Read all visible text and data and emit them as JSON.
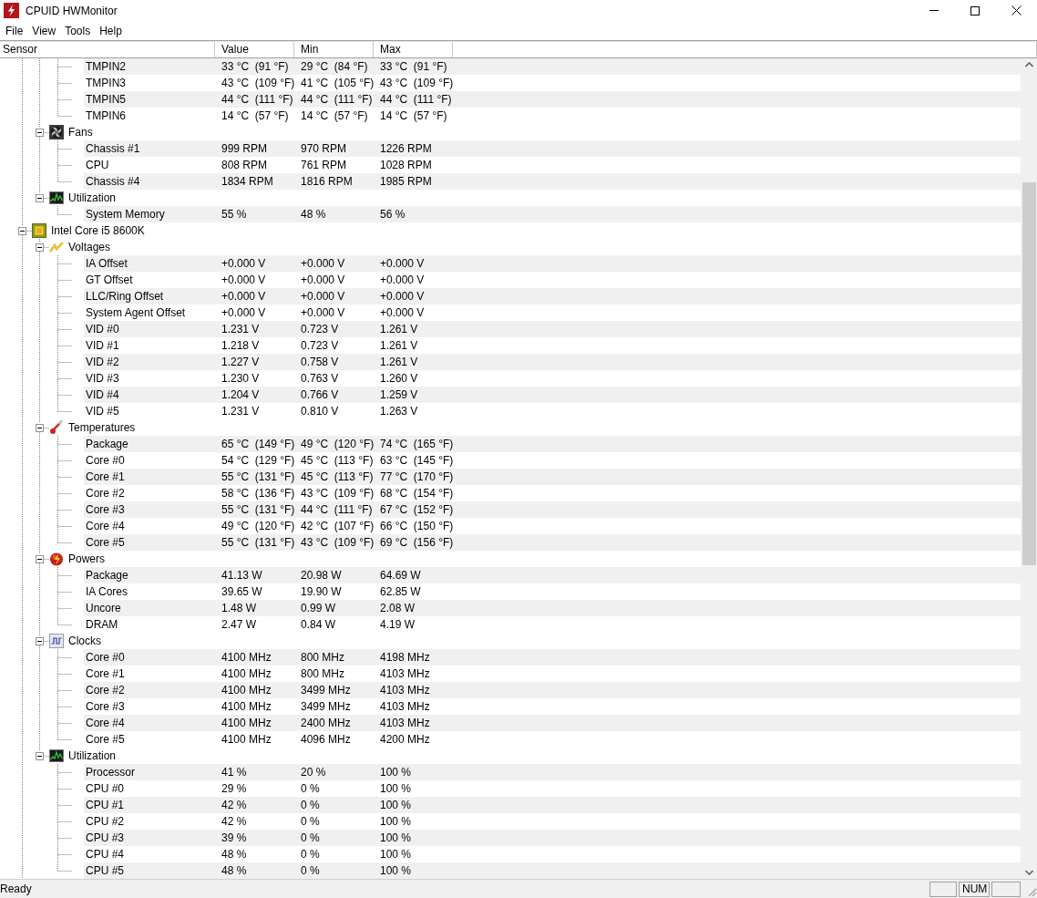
{
  "window": {
    "title": "CPUID HWMonitor"
  },
  "menu": [
    "File",
    "View",
    "Tools",
    "Help"
  ],
  "columns": [
    "Sensor",
    "Value",
    "Min",
    "Max"
  ],
  "tree": [
    {
      "children": [
        {
          "children": [
            {
              "label": "TMPIN2",
              "value": "33 °C  (91 °F)",
              "min": "29 °C  (84 °F)",
              "max": "33 °C  (91 °F)"
            },
            {
              "label": "TMPIN3",
              "value": "43 °C  (109 °F)",
              "min": "41 °C  (105 °F)",
              "max": "43 °C  (109 °F)"
            },
            {
              "label": "TMPIN5",
              "value": "44 °C  (111 °F)",
              "min": "44 °C  (111 °F)",
              "max": "44 °C  (111 °F)"
            },
            {
              "label": "TMPIN6",
              "value": "14 °C  (57 °F)",
              "min": "14 °C  (57 °F)",
              "max": "14 °C  (57 °F)"
            }
          ]
        },
        {
          "label": "Fans",
          "kind": "fans",
          "expanded": true,
          "children": [
            {
              "label": "Chassis #1",
              "value": "999 RPM",
              "min": "970 RPM",
              "max": "1226 RPM"
            },
            {
              "label": "CPU",
              "value": "808 RPM",
              "min": "761 RPM",
              "max": "1028 RPM"
            },
            {
              "label": "Chassis #4",
              "value": "1834 RPM",
              "min": "1816 RPM",
              "max": "1985 RPM"
            }
          ]
        },
        {
          "label": "Utilization",
          "kind": "utilization",
          "expanded": true,
          "children": [
            {
              "label": "System Memory",
              "value": "55 %",
              "min": "48 %",
              "max": "56 %"
            }
          ]
        }
      ]
    },
    {
      "label": "Intel Core i5 8600K",
      "kind": "processor",
      "expanded": true,
      "children": [
        {
          "label": "Voltages",
          "kind": "voltages",
          "expanded": true,
          "children": [
            {
              "label": "IA Offset",
              "value": "+0.000 V",
              "min": "+0.000 V",
              "max": "+0.000 V"
            },
            {
              "label": "GT Offset",
              "value": "+0.000 V",
              "min": "+0.000 V",
              "max": "+0.000 V"
            },
            {
              "label": "LLC/Ring Offset",
              "value": "+0.000 V",
              "min": "+0.000 V",
              "max": "+0.000 V"
            },
            {
              "label": "System Agent Offset",
              "value": "+0.000 V",
              "min": "+0.000 V",
              "max": "+0.000 V"
            },
            {
              "label": "VID #0",
              "value": "1.231 V",
              "min": "0.723 V",
              "max": "1.261 V"
            },
            {
              "label": "VID #1",
              "value": "1.218 V",
              "min": "0.723 V",
              "max": "1.261 V"
            },
            {
              "label": "VID #2",
              "value": "1.227 V",
              "min": "0.758 V",
              "max": "1.261 V"
            },
            {
              "label": "VID #3",
              "value": "1.230 V",
              "min": "0.763 V",
              "max": "1.260 V"
            },
            {
              "label": "VID #4",
              "value": "1.204 V",
              "min": "0.766 V",
              "max": "1.259 V"
            },
            {
              "label": "VID #5",
              "value": "1.231 V",
              "min": "0.810 V",
              "max": "1.263 V"
            }
          ]
        },
        {
          "label": "Temperatures",
          "kind": "temperatures",
          "expanded": true,
          "children": [
            {
              "label": "Package",
              "value": "65 °C  (149 °F)",
              "min": "49 °C  (120 °F)",
              "max": "74 °C  (165 °F)"
            },
            {
              "label": "Core #0",
              "value": "54 °C  (129 °F)",
              "min": "45 °C  (113 °F)",
              "max": "63 °C  (145 °F)"
            },
            {
              "label": "Core #1",
              "value": "55 °C  (131 °F)",
              "min": "45 °C  (113 °F)",
              "max": "77 °C  (170 °F)"
            },
            {
              "label": "Core #2",
              "value": "58 °C  (136 °F)",
              "min": "43 °C  (109 °F)",
              "max": "68 °C  (154 °F)"
            },
            {
              "label": "Core #3",
              "value": "55 °C  (131 °F)",
              "min": "44 °C  (111 °F)",
              "max": "67 °C  (152 °F)"
            },
            {
              "label": "Core #4",
              "value": "49 °C  (120 °F)",
              "min": "42 °C  (107 °F)",
              "max": "66 °C  (150 °F)"
            },
            {
              "label": "Core #5",
              "value": "55 °C  (131 °F)",
              "min": "43 °C  (109 °F)",
              "max": "69 °C  (156 °F)"
            }
          ]
        },
        {
          "label": "Powers",
          "kind": "powers",
          "expanded": true,
          "children": [
            {
              "label": "Package",
              "value": "41.13 W",
              "min": "20.98 W",
              "max": "64.69 W"
            },
            {
              "label": "IA Cores",
              "value": "39.65 W",
              "min": "19.90 W",
              "max": "62.85 W"
            },
            {
              "label": "Uncore",
              "value": "1.48 W",
              "min": "0.99 W",
              "max": "2.08 W"
            },
            {
              "label": "DRAM",
              "value": "2.47 W",
              "min": "0.84 W",
              "max": "4.19 W"
            }
          ]
        },
        {
          "label": "Clocks",
          "kind": "clocks",
          "expanded": true,
          "children": [
            {
              "label": "Core #0",
              "value": "4100 MHz",
              "min": "800 MHz",
              "max": "4198 MHz"
            },
            {
              "label": "Core #1",
              "value": "4100 MHz",
              "min": "800 MHz",
              "max": "4103 MHz"
            },
            {
              "label": "Core #2",
              "value": "4100 MHz",
              "min": "3499 MHz",
              "max": "4103 MHz"
            },
            {
              "label": "Core #3",
              "value": "4100 MHz",
              "min": "3499 MHz",
              "max": "4103 MHz"
            },
            {
              "label": "Core #4",
              "value": "4100 MHz",
              "min": "2400 MHz",
              "max": "4103 MHz"
            },
            {
              "label": "Core #5",
              "value": "4100 MHz",
              "min": "4096 MHz",
              "max": "4200 MHz"
            }
          ]
        },
        {
          "label": "Utilization",
          "kind": "utilization",
          "expanded": true,
          "children": [
            {
              "label": "Processor",
              "value": "41 %",
              "min": "20 %",
              "max": "100 %"
            },
            {
              "label": "CPU #0",
              "value": "29 %",
              "min": "0 %",
              "max": "100 %"
            },
            {
              "label": "CPU #1",
              "value": "42 %",
              "min": "0 %",
              "max": "100 %"
            },
            {
              "label": "CPU #2",
              "value": "42 %",
              "min": "0 %",
              "max": "100 %"
            },
            {
              "label": "CPU #3",
              "value": "39 %",
              "min": "0 %",
              "max": "100 %"
            },
            {
              "label": "CPU #4",
              "value": "48 %",
              "min": "0 %",
              "max": "100 %"
            },
            {
              "label": "CPU #5",
              "value": "48 %",
              "min": "0 %",
              "max": "100 %"
            }
          ]
        }
      ]
    }
  ],
  "status_bar": {
    "text": "Ready",
    "indicators": [
      "NUM"
    ]
  }
}
